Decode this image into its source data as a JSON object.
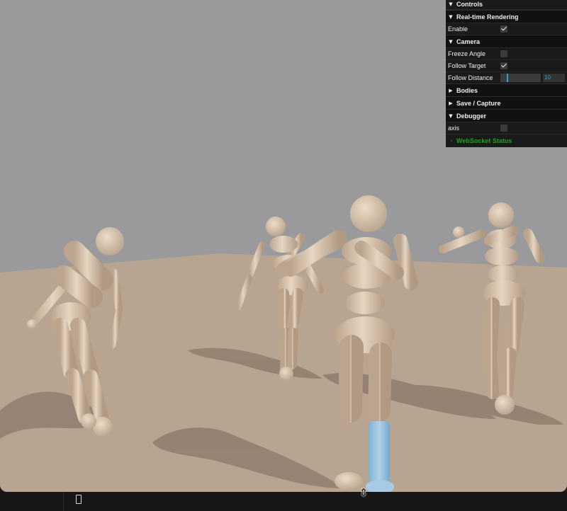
{
  "colors": {
    "sky": "#9a9a9c",
    "ground": "#b8a591",
    "body": "#d8c4ad",
    "shadow": "#8f7f70",
    "highlight_limb": "#8fbad8",
    "panel_bg": "#1a1a1a",
    "accent_blue": "#2f9fd8",
    "status_green": "#18a41a"
  },
  "gui": {
    "title": "Controls",
    "folders": {
      "realtime": {
        "label": "Real-time Rendering",
        "enable_label": "Enable",
        "enable_checked": true
      },
      "camera": {
        "label": "Camera",
        "freeze_label": "Freeze Angle",
        "freeze_checked": false,
        "follow_label": "Follow Target",
        "follow_checked": true,
        "distance_label": "Follow Distance",
        "distance_value": "10"
      },
      "bodies": {
        "label": "Bodies"
      },
      "save": {
        "label": "Save / Capture"
      },
      "debugger": {
        "label": "Debugger",
        "axis_label": "axis",
        "axis_checked": false
      }
    },
    "websocket_label": "WebSocket Status",
    "icons": {
      "open": "chevron-down-icon",
      "closed": "chevron-right-icon"
    }
  },
  "scene": {
    "figures": [
      "figure-left",
      "figure-middle-back",
      "figure-center-front",
      "figure-right"
    ]
  }
}
